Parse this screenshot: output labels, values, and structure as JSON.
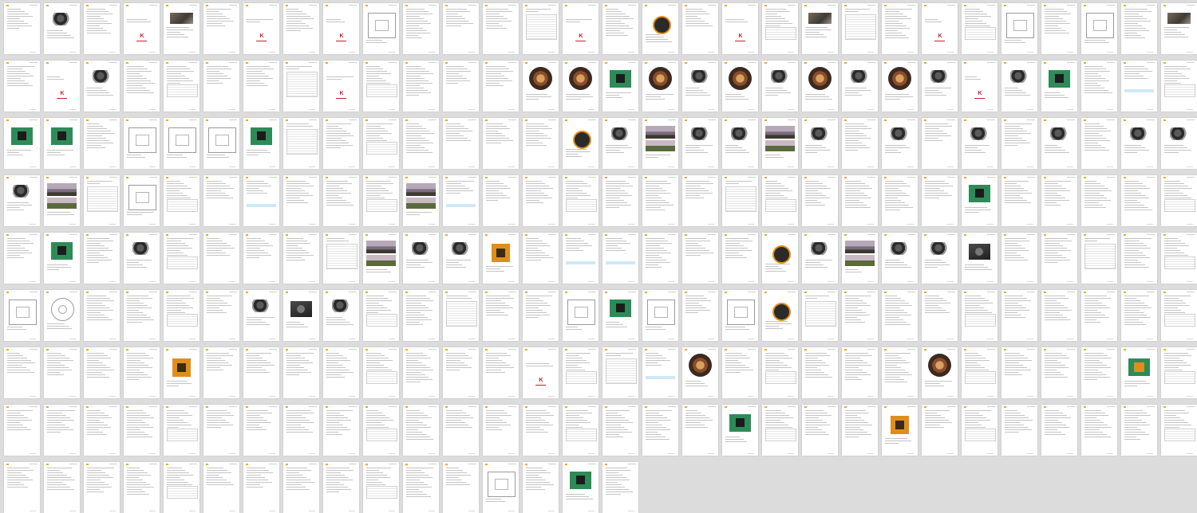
{
  "viewer": {
    "view": "page thumbnail grid",
    "columns": 30,
    "rows": 9,
    "page_count": 272
  },
  "colors": {
    "background": "#dcdcdc",
    "page": "#ffffff",
    "accent": "#f5a623",
    "logo": "#c81d2d",
    "callout_blue": "#cfe8f7",
    "callout_orange": "#ffe0cc",
    "text_line": "#c4c4c4",
    "pcb_green": "#2e8b57",
    "orange_board": "#e08e1b"
  },
  "rows": [
    "cpclfclcldccctlcrclcftclcdcdcf",
    "clpcccctlcccciigipipipiplpgcbc",
    "ggcdddgtccccccrpwppwpcpcpcpcpp",
    "pwtdccbcccwbcccccctcccccgccccc",
    "cgcpcccctwppocbbcccrpwppxcctcc",
    "dnccccpxpcctccdgdcdrtccccccccc",
    "ccccocccccccclctbiccccciccccvc",
    "ccccccccccccccccccgcccoccccccc",
    "ccccccccccccdcgc"
  ],
  "kind_legend": {
    "c": "text",
    "p": "product-photo",
    "l": "logo-page",
    "f": "figure",
    "t": "table",
    "d": "diagram",
    "g": "pcb-board",
    "r": "ring-lens",
    "b": "blue-callout",
    "i": "circular-image",
    "w": "wide-photo",
    "o": "orange-board",
    "x": "case-photo",
    "n": "lens-diagram",
    "v": "pcb-orange"
  }
}
